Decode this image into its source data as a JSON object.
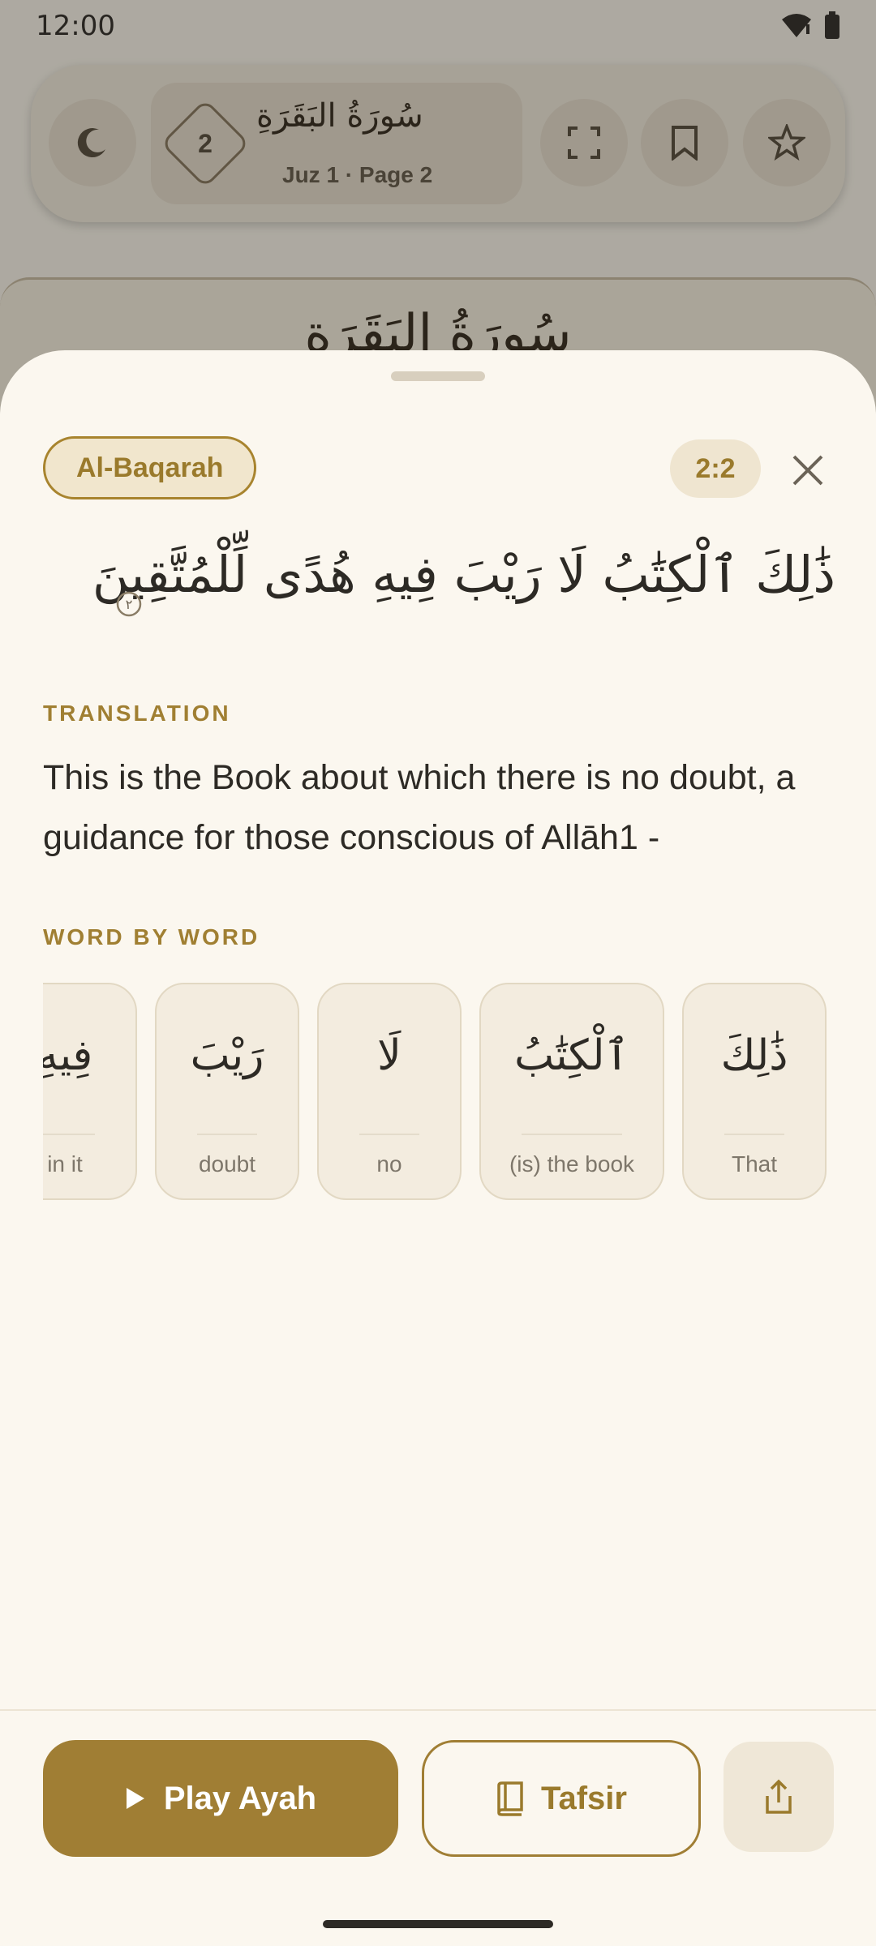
{
  "status": {
    "time": "12:00"
  },
  "topbar": {
    "page_number": "2",
    "surah_arabic": "سُورَةُ البَقَرَةِ",
    "subtitle": "Juz 1 · Page 2"
  },
  "background_page": {
    "title_arabic": "سُورَةُ البَقَرَةِ"
  },
  "sheet": {
    "surah_name": "Al-Baqarah",
    "verse_ref": "2:2",
    "arabic_text": "ذَٰلِكَ ٱلْكِتَٰبُ لَا رَيْبَ فِيهِ هُدًى لِّلْمُتَّقِينَ",
    "ayah_number_glyph": "٢",
    "translation_label": "TRANSLATION",
    "translation": "This is the Book about which there is no doubt, a guidance for those conscious of Allāh1 -",
    "wbw_label": "WORD BY WORD",
    "words": [
      {
        "arabic": "ذَٰلِكَ",
        "english": "That"
      },
      {
        "arabic": "ٱلْكِتَٰبُ",
        "english": "(is) the book"
      },
      {
        "arabic": "لَا",
        "english": "no"
      },
      {
        "arabic": "رَيْبَ",
        "english": "doubt"
      },
      {
        "arabic": "فِيهِ",
        "english": "in it"
      }
    ]
  },
  "actions": {
    "play_label": "Play Ayah",
    "tafsir_label": "Tafsir"
  },
  "colors": {
    "accent": "#a07e34",
    "sheet_bg": "#fbf7ef",
    "chip_bg": "#f1e6cd"
  },
  "icons": {
    "theme": "moon-icon",
    "fullscreen": "fullscreen-icon",
    "bookmark": "bookmark-icon",
    "favorite": "star-icon",
    "close": "close-icon",
    "play": "play-icon",
    "tafsir": "book-icon",
    "share": "share-icon"
  }
}
